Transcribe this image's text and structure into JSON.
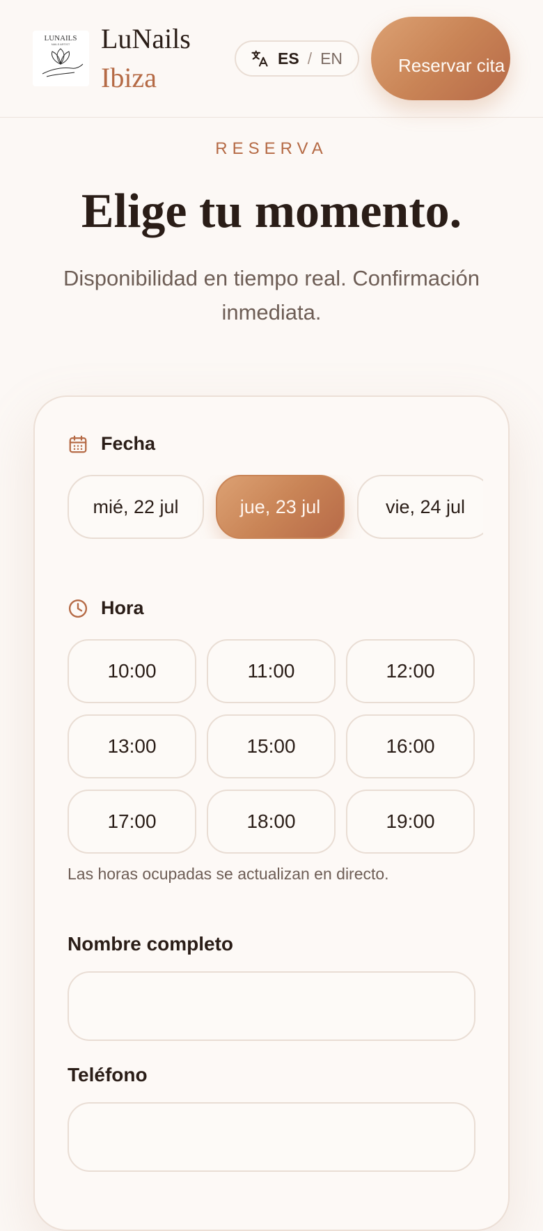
{
  "header": {
    "logo_text": "LUNAILS",
    "logo_subtext": "NAILS ARTIST",
    "brand_name": "LuNails",
    "brand_location": "Ibiza",
    "lang": {
      "active": "ES",
      "separator": "/",
      "other": "EN",
      "icon": "translate-icon"
    },
    "book_button": "Reservar cita"
  },
  "hero": {
    "eyebrow": "RESERVA",
    "title": "Elige tu momento.",
    "subtitle": "Disponibilidad en tiempo real. Confirmación inmediata."
  },
  "booking": {
    "date_label": "Fecha",
    "date_icon": "calendar-icon",
    "dates": [
      {
        "label": "mié, 22 jul",
        "selected": false
      },
      {
        "label": "jue, 23 jul",
        "selected": true
      },
      {
        "label": "vie, 24 jul",
        "selected": false
      }
    ],
    "time_label": "Hora",
    "time_icon": "clock-icon",
    "times": [
      "10:00",
      "11:00",
      "12:00",
      "13:00",
      "15:00",
      "16:00",
      "17:00",
      "18:00",
      "19:00"
    ],
    "hint": "Las horas ocupadas se actualizan en directo.",
    "name_label": "Nombre completo",
    "name_value": "",
    "phone_label": "Teléfono",
    "phone_value": ""
  },
  "colors": {
    "accent": "#c98456",
    "accent_dark": "#b56a45",
    "background": "#fcf8f5",
    "text": "#2a1d17"
  }
}
